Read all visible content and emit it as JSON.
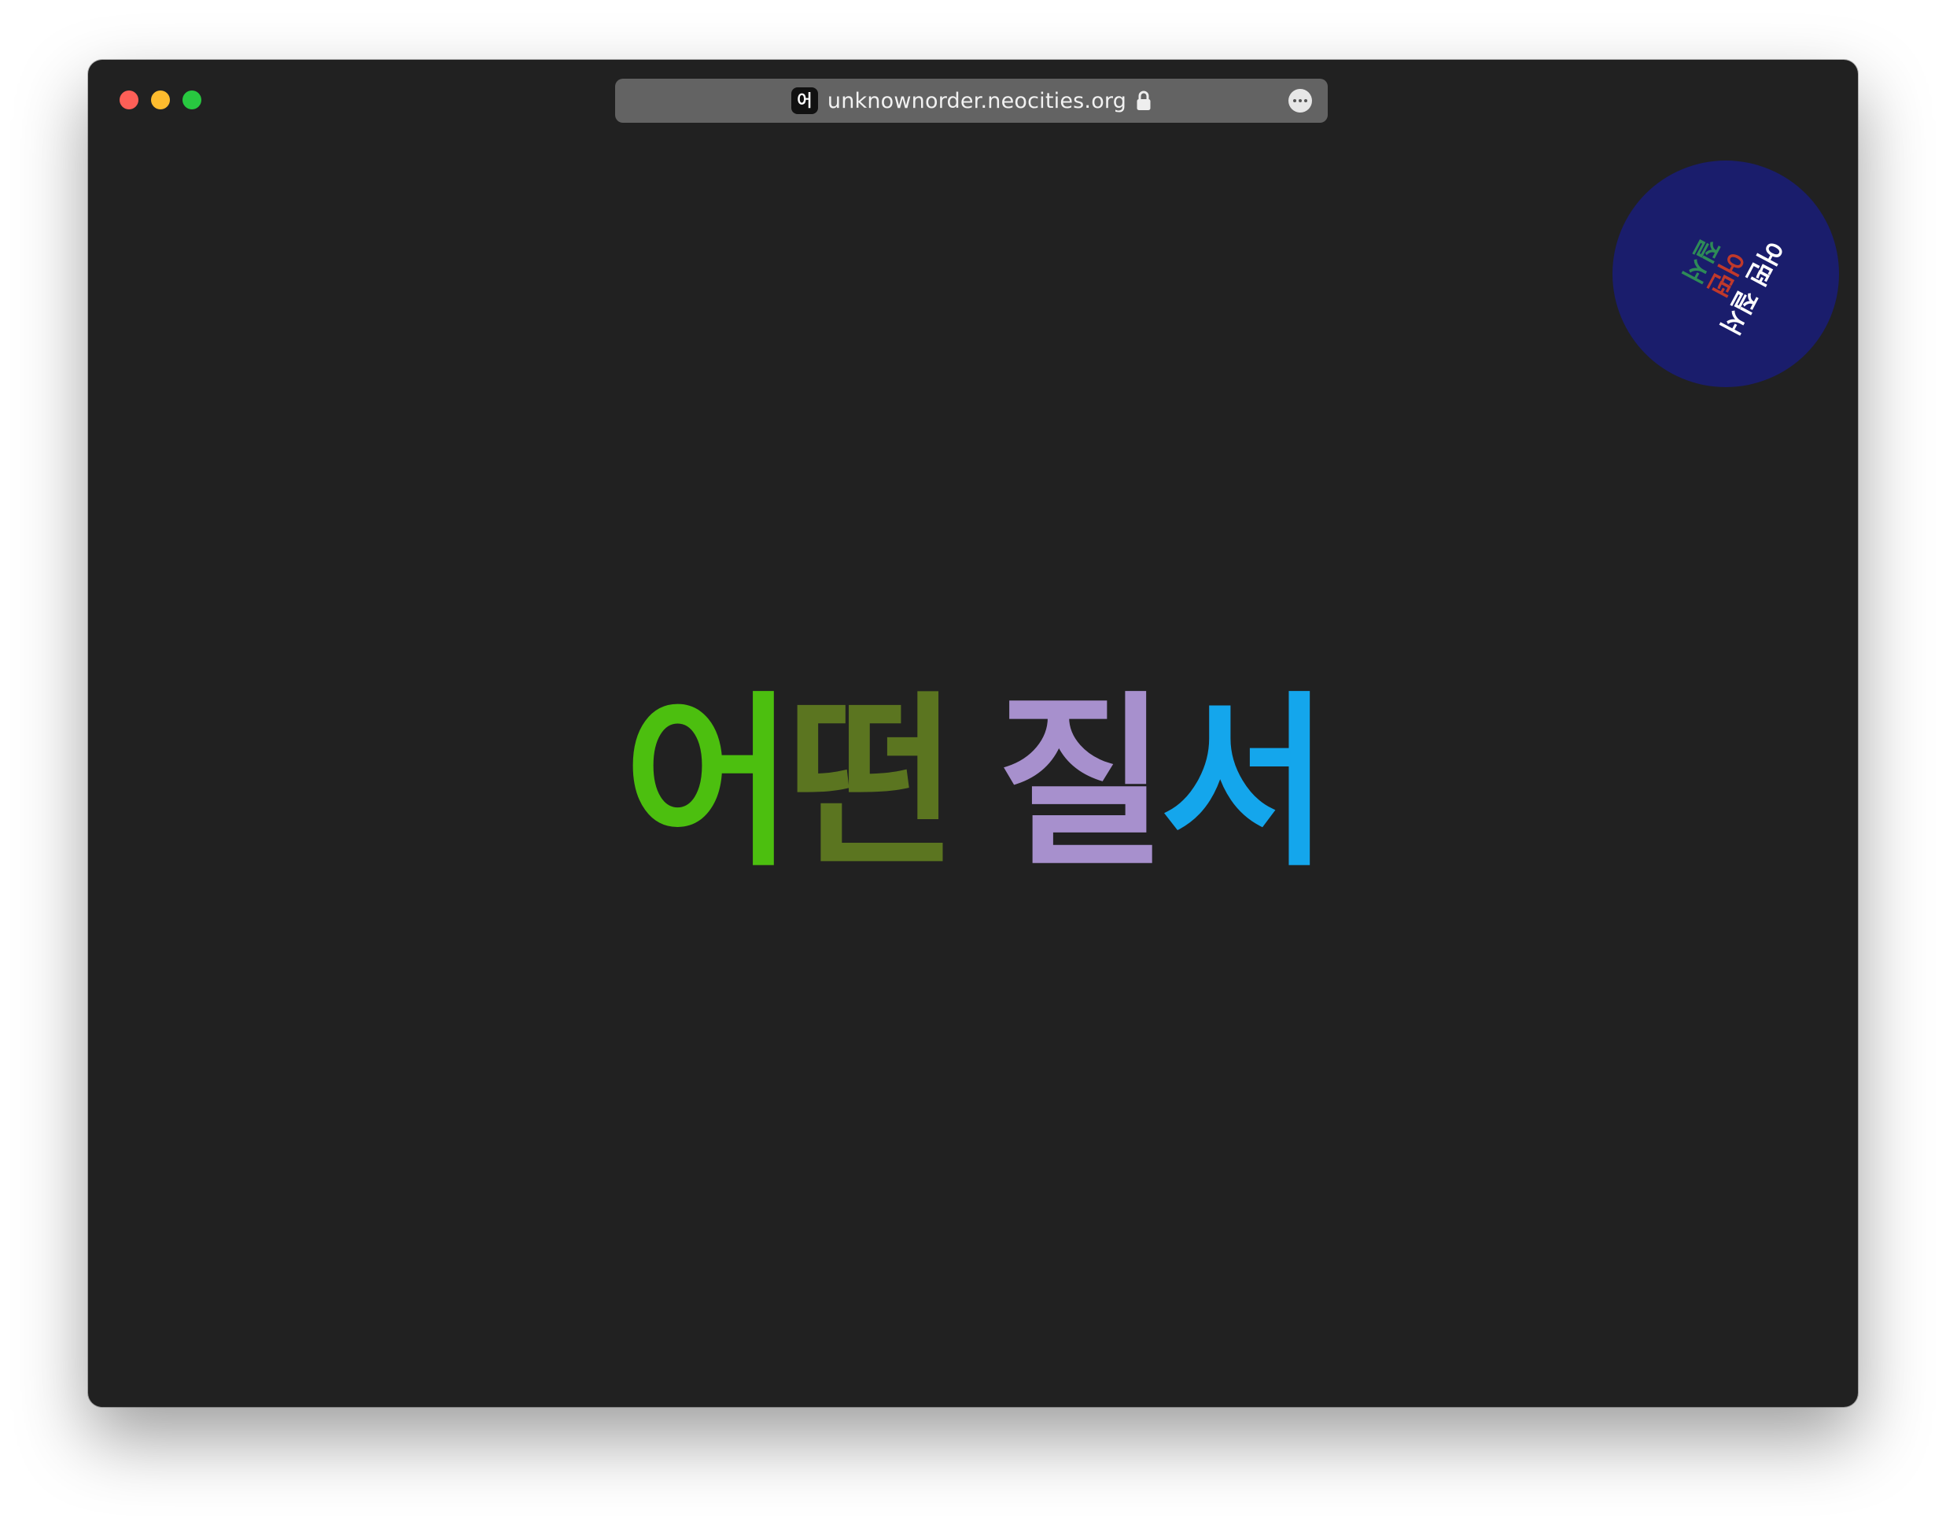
{
  "browser": {
    "favicon_glyph": "어",
    "url": "unknownorder.neocities.org",
    "icons": {
      "lock": "lock-icon",
      "more": "more-options-icon"
    }
  },
  "title": {
    "chars": [
      {
        "text": "어",
        "color": "#4cbf0f"
      },
      {
        "text": "떤",
        "color": "#5b7520"
      },
      {
        "text": "질",
        "color": "#a790cd"
      },
      {
        "text": "서",
        "color": "#14a6ec"
      }
    ]
  },
  "badge": {
    "background": "#1a1d6c",
    "lines": [
      {
        "text": "어떤 질서",
        "color": "#ffffff"
      },
      {
        "text": "어떤",
        "color": "#c0392b"
      },
      {
        "text": "질서",
        "color": "#2e8b57"
      }
    ]
  }
}
